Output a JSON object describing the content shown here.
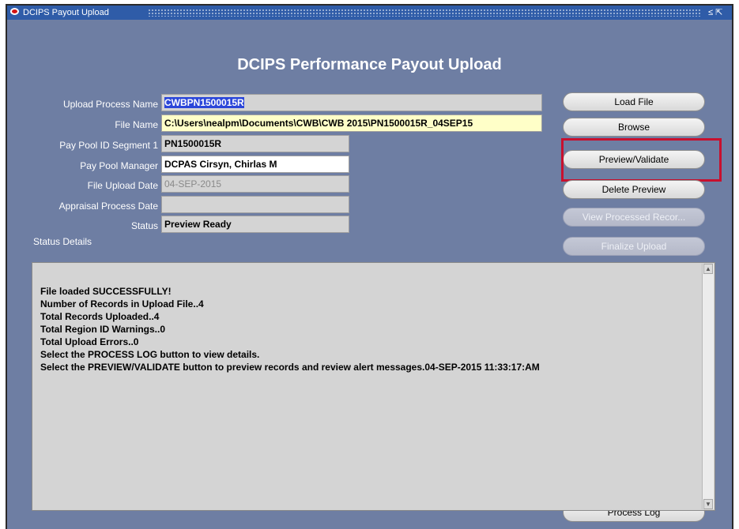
{
  "window": {
    "title": "DCIPS Payout Upload",
    "controls": "≤ ⇱"
  },
  "form": {
    "heading": "DCIPS Performance Payout Upload",
    "fields": {
      "upload_process_name": {
        "label": "Upload Process Name",
        "value": "CWBPN1500015R"
      },
      "file_name": {
        "label": "File Name",
        "value": "C:\\Users\\nealpm\\Documents\\CWB\\CWB 2015\\PN1500015R_04SEP15"
      },
      "pay_pool_id": {
        "label": "Pay Pool ID Segment 1",
        "value": "PN1500015R"
      },
      "pay_pool_manager": {
        "label": "Pay Pool Manager",
        "value": "DCPAS Cirsyn, Chirlas M"
      },
      "file_upload_date": {
        "label": "File Upload Date",
        "value": "04-SEP-2015"
      },
      "appraisal_process_date": {
        "label": "Appraisal Process Date",
        "value": ""
      },
      "status": {
        "label": "Status",
        "value": "Preview Ready"
      }
    },
    "status_details_label": "Status Details",
    "status_lines": [
      "File loaded SUCCESSFULLY!",
      "Number of Records in Upload File..4",
      "Total Records Uploaded..4",
      "Total Region ID Warnings..0",
      "Total Upload Errors..0",
      "Select the PROCESS LOG button to view details.",
      "Select the PREVIEW/VALIDATE button to preview records and review alert messages.04-SEP-2015 11:33:17:AM"
    ]
  },
  "buttons": {
    "load_file": "Load File",
    "browse": "Browse",
    "preview_validate": "Preview/Validate",
    "delete_preview": "Delete Preview",
    "view_processed_records": "View Processed Recor...",
    "finalize_upload": "Finalize Upload",
    "process_log": "Process Log"
  },
  "colors": {
    "window_bg": "#6e7ea3",
    "titlebar": "#2f5ca8",
    "highlight": "#c8102e",
    "selection": "#2b46d9",
    "file_name_bg": "#ffffc8"
  }
}
